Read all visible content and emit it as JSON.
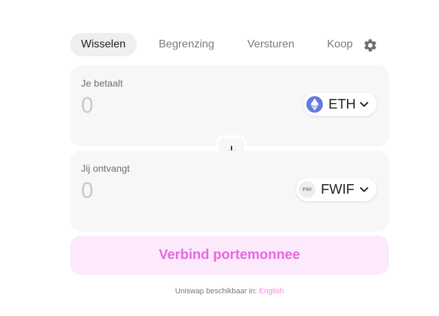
{
  "tabs": [
    {
      "label": "Wisselen"
    },
    {
      "label": "Begrenzing"
    },
    {
      "label": "Versturen"
    },
    {
      "label": "Koop"
    }
  ],
  "icons": {
    "settings": "gear-icon",
    "swap": "arrow-down-icon",
    "chevron": "chevron-down-icon",
    "eth_logo": "ethereum-icon"
  },
  "pay": {
    "label": "Je betaalt",
    "placeholder": "0",
    "token": {
      "symbol": "ETH",
      "color": "#6279df"
    }
  },
  "receive": {
    "label": "Jij ontvangt",
    "placeholder": "0",
    "token": {
      "symbol": "FWIF",
      "icon_text": "FWI"
    }
  },
  "connect_button": {
    "label": "Verbind portemonnee",
    "bg": "#fde9fc",
    "color": "#e36ae0"
  },
  "footer": {
    "text": "Uniswap beschikbaar in: ",
    "language": "English",
    "link_color": "#f487ef"
  }
}
